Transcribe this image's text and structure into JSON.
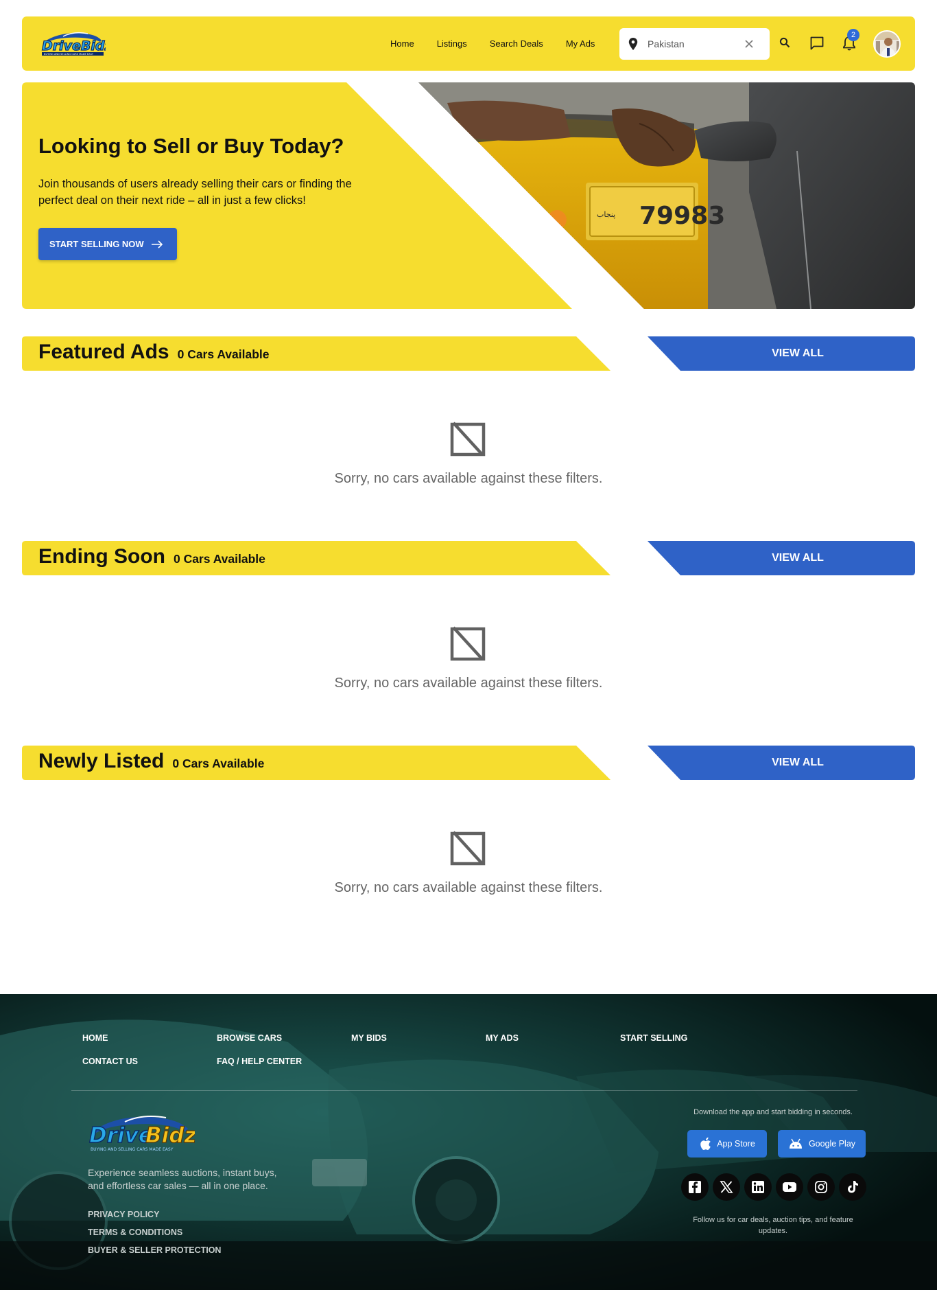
{
  "brand": {
    "name": "DriveBidz",
    "tagline": "BUYING AND SELLING CARS MADE EASY"
  },
  "nav": {
    "links": [
      "Home",
      "Listings",
      "Search Deals",
      "My Ads"
    ],
    "location_value": "Pakistan",
    "location_placeholder": "Location",
    "notification_count": "2"
  },
  "hero": {
    "title": "Looking to Sell or Buy Today?",
    "subtitle": "Join thousands of users already selling their cars or finding the perfect deal on their next ride – all in just a few clicks!",
    "cta": "START SELLING NOW",
    "plate_text": "79983"
  },
  "sections": [
    {
      "title": "Featured Ads",
      "count": "0 Cars Available",
      "view_all": "VIEW ALL",
      "empty": "Sorry, no cars available against these filters."
    },
    {
      "title": "Ending Soon",
      "count": "0 Cars Available",
      "view_all": "VIEW ALL",
      "empty": "Sorry, no cars available against these filters."
    },
    {
      "title": "Newly Listed",
      "count": "0 Cars Available",
      "view_all": "VIEW ALL",
      "empty": "Sorry, no cars available against these filters."
    }
  ],
  "footer": {
    "links_row1": [
      "HOME",
      "BROWSE CARS",
      "MY BIDS",
      "MY ADS",
      "START SELLING"
    ],
    "links_row2": [
      "CONTACT US",
      "FAQ / HELP CENTER"
    ],
    "description": "Experience seamless auctions, instant buys, and effortless car sales — all in one place.",
    "legal": [
      "PRIVACY POLICY",
      "TERMS & CONDITIONS",
      "BUYER & SELLER PROTECTION"
    ],
    "download_text": "Download the app and start bidding in seconds.",
    "app_store": "App Store",
    "google_play": "Google Play",
    "social_icons": [
      "facebook-icon",
      "x-icon",
      "linkedin-icon",
      "youtube-icon",
      "instagram-icon",
      "tiktok-icon"
    ],
    "follow_text": "Follow us for car deals, auction tips, and feature updates."
  },
  "colors": {
    "yellow": "#f6dd2f",
    "blue": "#2f62c7",
    "footer_bg": "#061412"
  }
}
